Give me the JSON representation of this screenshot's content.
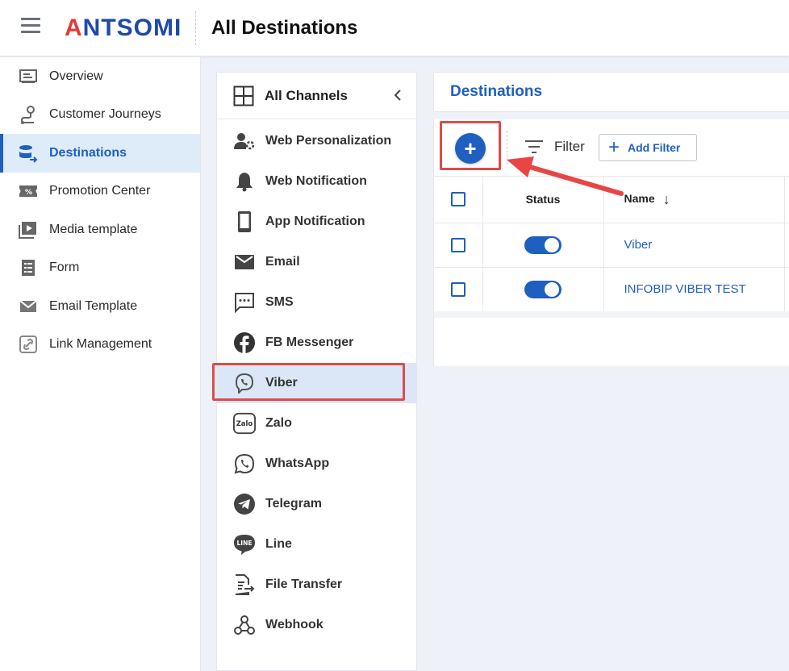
{
  "header": {
    "logo_text": "ANTSOMI",
    "title": "All Destinations"
  },
  "sidebar": {
    "items": [
      {
        "label": "Overview",
        "icon": "overview-icon",
        "active": false
      },
      {
        "label": "Customer Journeys",
        "icon": "journey-icon",
        "active": false
      },
      {
        "label": "Destinations",
        "icon": "destinations-icon",
        "active": true
      },
      {
        "label": "Promotion Center",
        "icon": "promotion-icon",
        "active": false
      },
      {
        "label": "Media template",
        "icon": "media-icon",
        "active": false
      },
      {
        "label": "Form",
        "icon": "form-icon",
        "active": false
      },
      {
        "label": "Email Template",
        "icon": "email-template-icon",
        "active": false
      },
      {
        "label": "Link Management",
        "icon": "link-icon",
        "active": false
      }
    ]
  },
  "channels": {
    "header_label": "All Channels",
    "items": [
      {
        "label": "Web Personalization",
        "icon": "web-personalization-icon"
      },
      {
        "label": "Web Notification",
        "icon": "bell-icon"
      },
      {
        "label": "App Notification",
        "icon": "phone-icon"
      },
      {
        "label": "Email",
        "icon": "email-icon"
      },
      {
        "label": "SMS",
        "icon": "sms-icon"
      },
      {
        "label": "FB Messenger",
        "icon": "facebook-icon"
      },
      {
        "label": "Viber",
        "icon": "viber-icon",
        "active": true
      },
      {
        "label": "Zalo",
        "icon": "zalo-icon"
      },
      {
        "label": "WhatsApp",
        "icon": "whatsapp-icon"
      },
      {
        "label": "Telegram",
        "icon": "telegram-icon"
      },
      {
        "label": "Line",
        "icon": "line-icon"
      },
      {
        "label": "File Transfer",
        "icon": "file-transfer-icon"
      },
      {
        "label": "Webhook",
        "icon": "webhook-icon"
      }
    ]
  },
  "destinations": {
    "title": "Destinations",
    "add_symbol": "+",
    "filter_label": "Filter",
    "add_filter_label": "Add Filter",
    "columns": {
      "status": "Status",
      "name": "Name"
    },
    "rows": [
      {
        "name": "Viber",
        "status_on": true
      },
      {
        "name": "INFOBIP VIBER TEST",
        "status_on": true
      }
    ]
  },
  "colors": {
    "accent": "#1f5fbf",
    "highlight": "#e04a4a",
    "logo_red": "#e03b3b"
  }
}
